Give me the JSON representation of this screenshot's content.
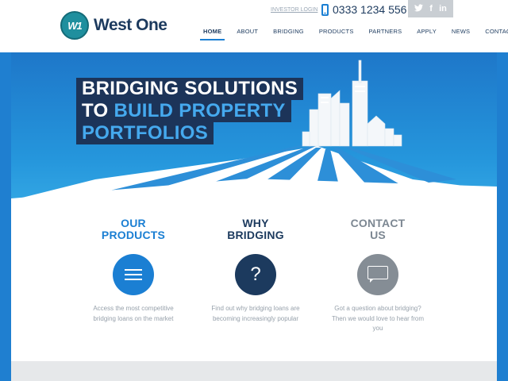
{
  "header": {
    "logo": {
      "mark": "W1",
      "name": "West One"
    },
    "investor_login": "INVESTOR LOGIN",
    "phone_number": "0333 1234 556",
    "social": {
      "twitter": "𝕋",
      "facebook": "f",
      "linkedin": "in"
    },
    "nav": [
      {
        "label": "HOME",
        "active": true
      },
      {
        "label": "ABOUT",
        "active": false
      },
      {
        "label": "BRIDGING",
        "active": false
      },
      {
        "label": "PRODUCTS",
        "active": false
      },
      {
        "label": "PARTNERS",
        "active": false
      },
      {
        "label": "APPLY",
        "active": false
      },
      {
        "label": "NEWS",
        "active": false
      },
      {
        "label": "CONTACT",
        "active": false
      }
    ]
  },
  "hero": {
    "line1": "BRIDGING SOLUTIONS",
    "line2_prefix": "TO ",
    "line2_accent": "BUILD PROPERTY",
    "line3": "PORTFOLIOS"
  },
  "features": [
    {
      "title_line1": "OUR",
      "title_line2": "PRODUCTS",
      "icon": "list-icon",
      "text": "Access the most competitive bridging loans on the market"
    },
    {
      "title_line1": "WHY",
      "title_line2": "BRIDGING",
      "icon": "question-icon",
      "text": "Find out why bridging loans are becoming increasingly popular",
      "glyph": "?"
    },
    {
      "title_line1": "CONTACT",
      "title_line2": "US",
      "icon": "speech-bubble-icon",
      "text": "Got a question about bridging? Then we would love to hear from you"
    }
  ],
  "colors": {
    "brand_blue": "#1b7fd3",
    "brand_navy": "#1c3a5e",
    "brand_grey": "#858d95",
    "logo_teal": "#1f8f9e"
  }
}
